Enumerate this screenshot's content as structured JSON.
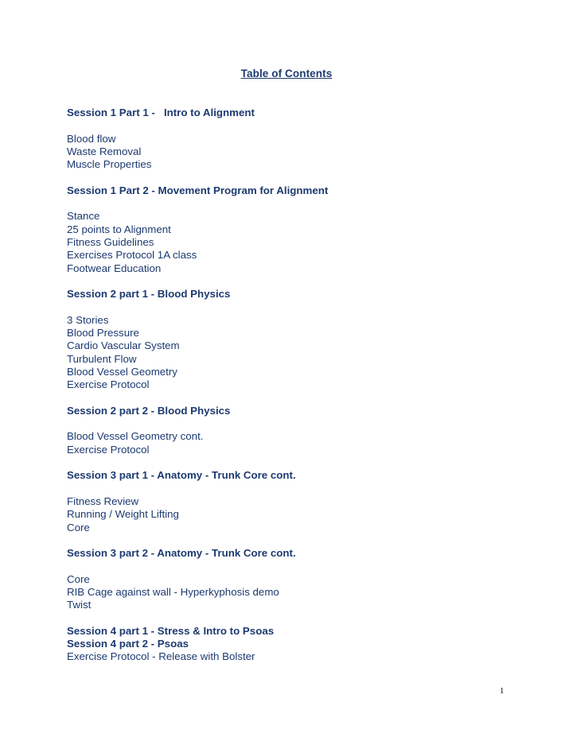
{
  "document": {
    "title": "Table of Contents",
    "page_number": "1",
    "text_color": "#1d3a70",
    "page_number_color": "#000000",
    "background_color": "#ffffff"
  },
  "sections": [
    {
      "heading": "Session 1 Part 1 -   Intro to Alignment",
      "items": [
        "Blood flow",
        "Waste Removal",
        "Muscle Properties"
      ]
    },
    {
      "heading": "Session 1 Part 2 - Movement Program for Alignment",
      "items": [
        "Stance",
        "25 points to Alignment",
        "Fitness Guidelines",
        "Exercises Protocol 1A class",
        "Footwear Education"
      ]
    },
    {
      "heading": "Session 2 part 1 - Blood Physics",
      "items": [
        "3 Stories",
        "Blood Pressure",
        "Cardio Vascular System",
        "Turbulent Flow",
        "Blood Vessel Geometry",
        "Exercise Protocol"
      ]
    },
    {
      "heading": "Session 2 part 2 - Blood Physics",
      "items": [
        "Blood Vessel Geometry cont.",
        "Exercise Protocol"
      ]
    },
    {
      "heading": "Session 3 part 1 - Anatomy - Trunk Core cont.",
      "items": [
        "Fitness Review",
        "Running / Weight Lifting",
        "Core"
      ]
    },
    {
      "heading": "Session 3 part 2 - Anatomy - Trunk Core cont.",
      "items": [
        "Core",
        "RIB Cage against wall - Hyperkyphosis demo",
        "Twist"
      ]
    },
    {
      "heading": "Session 4 part 1 - Stress & Intro to Psoas",
      "heading2": "Session 4 part 2 - Psoas",
      "items_tight": [
        "Exercise Protocol - Release with Bolster"
      ]
    }
  ]
}
